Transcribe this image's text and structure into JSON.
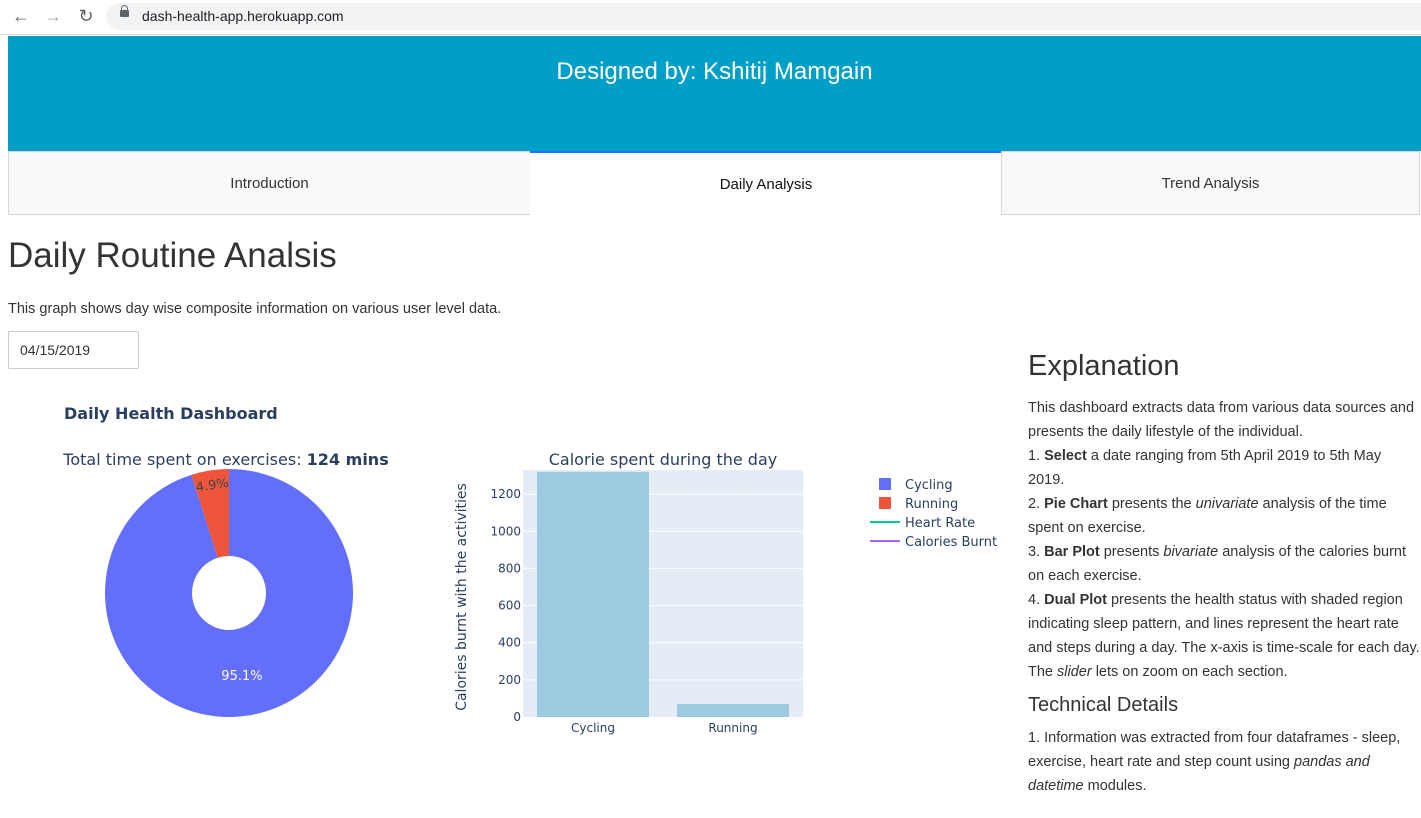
{
  "browser": {
    "url": "dash-health-app.herokuapp.com"
  },
  "header": {
    "title": "Designed by: Kshitij Mamgain"
  },
  "tabs": [
    {
      "label": "Introduction"
    },
    {
      "label": "Daily Analysis"
    },
    {
      "label": "Trend Analysis"
    }
  ],
  "page": {
    "title": "Daily Routine Analsis",
    "description": "This graph shows day wise composite information on various user level data.",
    "date_value": "04/15/2019",
    "dashboard_title": "Daily Health Dashboard"
  },
  "explanation": {
    "heading": "Explanation",
    "intro": "This dashboard extracts data from various data sources and presents the daily lifestyle of the individual.",
    "items": [
      {
        "num": "1. ",
        "bold": "Select",
        "rest": " a date ranging from 5th April 2019 to 5th May 2019."
      },
      {
        "num": "2. ",
        "bold": "Pie Chart",
        "pre": " presents the ",
        "italic": "univariate",
        "rest": " analysis of the time spent on exercise."
      },
      {
        "num": "3. ",
        "bold": "Bar Plot",
        "pre": " presents ",
        "italic": "bivariate",
        "rest": " analysis of the calories burnt on each exercise."
      },
      {
        "num": "4. ",
        "bold": "Dual Plot",
        "pre": " presents the health status with shaded region indicating sleep pattern, and lines represent the heart rate and steps during a day. The x-axis is time-scale for each day. The ",
        "italic": "slider",
        "rest": " lets on zoom on each section."
      }
    ],
    "tech_heading": "Technical Details",
    "tech_item": {
      "pre": "1. Information was extracted from four dataframes - sleep, exercise, heart rate and step count using ",
      "italic": "pandas and datetime",
      "rest": " modules."
    }
  },
  "chart_data": [
    {
      "type": "pie",
      "title_prefix": "Total time spent on exercises: ",
      "title_bold": "124 mins",
      "hole": true,
      "slices": [
        {
          "label": "Cycling",
          "percent": 95.1,
          "text": "95.1%",
          "color": "#636efa"
        },
        {
          "label": "Running",
          "percent": 4.9,
          "text": "4.9%",
          "color": "#ef553b"
        }
      ]
    },
    {
      "type": "bar",
      "title": "Calorie spent during the day",
      "categories": [
        "Cycling",
        "Running"
      ],
      "values": [
        1320,
        70
      ],
      "ylabel": "Calories burnt with the activities",
      "ylim": [
        0,
        1330
      ],
      "yticks": [
        0,
        200,
        400,
        600,
        800,
        1000,
        1200
      ],
      "bar_color": "#9ecae1",
      "plot_bg": "#e5ecf6",
      "grid": true
    }
  ],
  "legend": [
    {
      "name": "Cycling",
      "kind": "square",
      "color": "#636efa"
    },
    {
      "name": "Running",
      "kind": "square",
      "color": "#ef553b"
    },
    {
      "name": "Heart Rate",
      "kind": "line",
      "color": "#00cc96"
    },
    {
      "name": "Calories Burnt",
      "kind": "line",
      "color": "#ab63fa"
    }
  ]
}
